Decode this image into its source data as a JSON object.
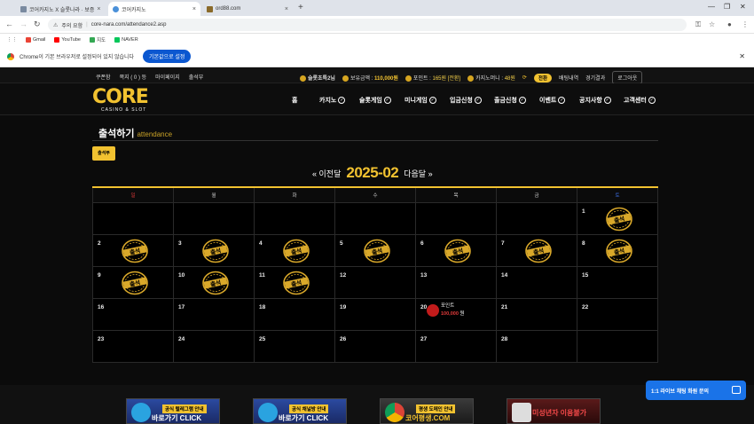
{
  "browser": {
    "tabs": [
      {
        "label": "코어카지노 X 슬롯나라 · 보증",
        "active": false
      },
      {
        "label": "코어카지노",
        "active": true
      },
      {
        "label": "ord88.com",
        "active": false
      }
    ],
    "warning": "주의 요함",
    "url": "core-nara.com/attendance2.asp",
    "bookmarks": [
      "Gmail",
      "YouTube",
      "지도",
      "NAVER"
    ],
    "infobar_text": "Chrome이 기본 브라우저로 설정되어 있지 않습니다",
    "infobar_button": "기본값으로 설정"
  },
  "site": {
    "top_left_links": [
      "쿠폰함",
      "쪽지 ( 0 ) 등",
      "마이페이지",
      "출석부"
    ],
    "user_level": "슬롯초특2님",
    "balance_label": "보유금액 :",
    "balance": "110,000원",
    "point_label": "포인트 :",
    "point": "165원 [전환]",
    "casino_money_label": "카지노머니 :",
    "casino_money": "48원",
    "convert_button": "전환",
    "betting_history": "배팅내역",
    "game_results": "경기결과",
    "logout": "로그아웃",
    "logo_text": "CORE",
    "logo_sub": "CASINO & SLOT",
    "menu": [
      "홈",
      "카지노",
      "슬롯게임",
      "미니게임",
      "입금신청",
      "출금신청",
      "이벤트",
      "공지사항",
      "고객센터"
    ]
  },
  "attendance": {
    "title": "출석하기",
    "subtitle": "attendance",
    "button": "출석부",
    "prev": "« 이전달",
    "month": "2025-02",
    "next": "다음달 »",
    "weekdays": [
      "일",
      "월",
      "화",
      "수",
      "목",
      "금",
      "토"
    ],
    "stamp_text": "출석",
    "prize_label": "포인트",
    "prize_value": "100,000",
    "prize_unit": "원"
  },
  "banners": [
    {
      "tag": "공식 텔레그램 안내",
      "text": "바로가기 CLICK"
    },
    {
      "tag": "공식 채널방 안내",
      "text": "바로가기 CLICK"
    },
    {
      "tag": "평생 도메인 안내",
      "text": "코어평생.COM"
    },
    {
      "tag": "미성년자 이용불가",
      "text": ""
    }
  ],
  "chat_label": "1:1 라이브 채팅 화원 문의",
  "colors": {
    "accent": "#f2c230",
    "sunday": "#e23a3a",
    "saturday": "#3d6fe6",
    "chat": "#1a73e8"
  }
}
